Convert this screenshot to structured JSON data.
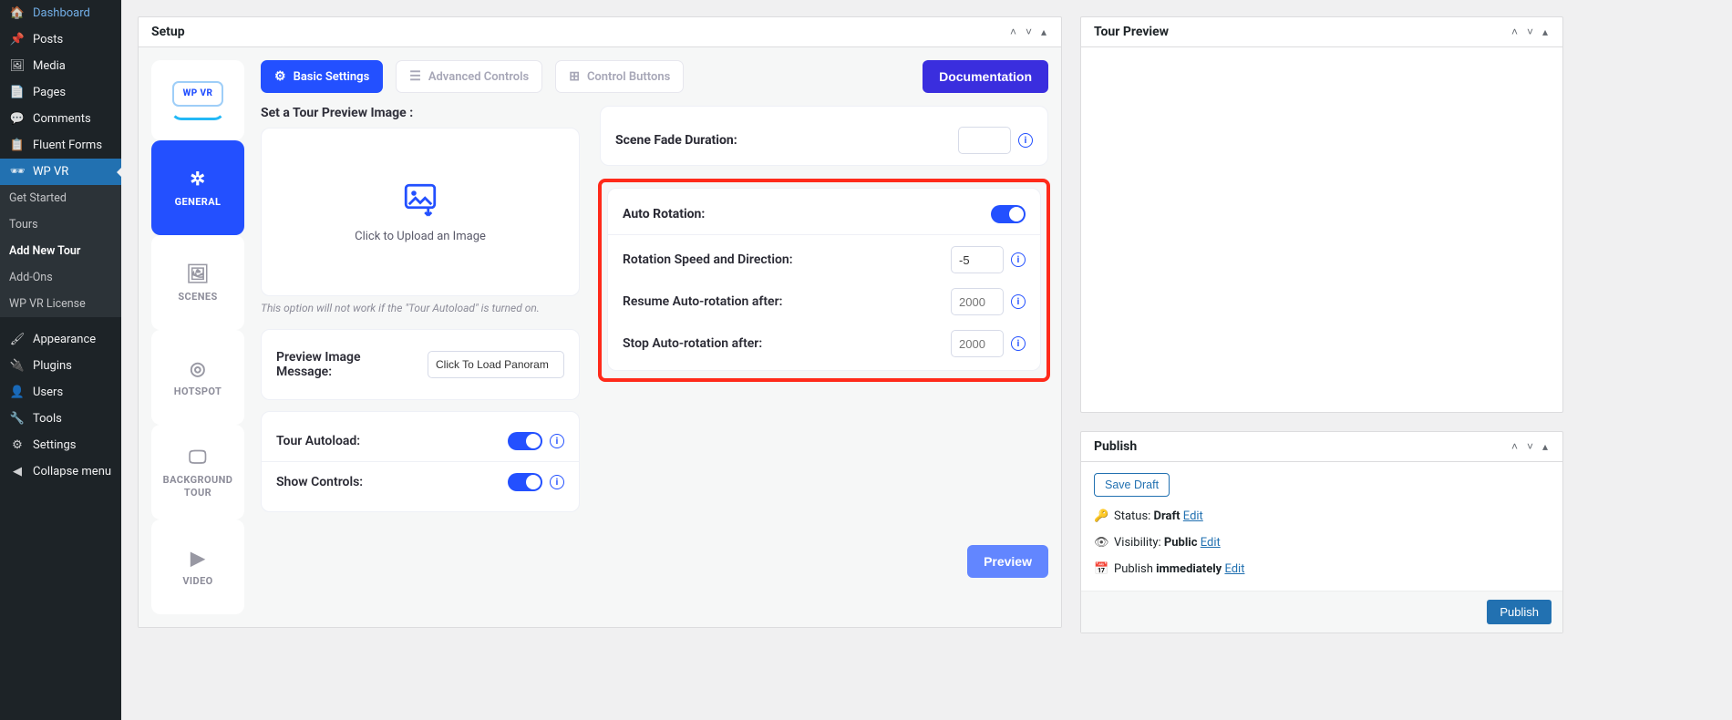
{
  "sidebar": {
    "items": [
      {
        "label": "Dashboard",
        "icon": "🏠"
      },
      {
        "label": "Posts",
        "icon": "📌"
      },
      {
        "label": "Media",
        "icon": "🖼"
      },
      {
        "label": "Pages",
        "icon": "📄"
      },
      {
        "label": "Comments",
        "icon": "💬"
      },
      {
        "label": "Fluent Forms",
        "icon": "📋"
      },
      {
        "label": "WP VR",
        "icon": "🕶",
        "active": true,
        "sub": [
          {
            "label": "Get Started"
          },
          {
            "label": "Tours"
          },
          {
            "label": "Add New Tour",
            "current": true
          },
          {
            "label": "Add-Ons"
          },
          {
            "label": "WP VR License"
          }
        ]
      },
      {
        "label": "Appearance",
        "icon": "🖌"
      },
      {
        "label": "Plugins",
        "icon": "🔌"
      },
      {
        "label": "Users",
        "icon": "👤"
      },
      {
        "label": "Tools",
        "icon": "🔧"
      },
      {
        "label": "Settings",
        "icon": "⚙"
      },
      {
        "label": "Collapse menu",
        "icon": "◀"
      }
    ]
  },
  "setup": {
    "title": "Setup",
    "logo_text": "WP VR",
    "vtabs": [
      {
        "label": "GENERAL",
        "icon": "✲"
      },
      {
        "label": "SCENES",
        "icon": "🖼"
      },
      {
        "label": "HOTSPOT",
        "icon": "◎"
      },
      {
        "label": "BACKGROUND TOUR",
        "icon": "🖵"
      },
      {
        "label": "VIDEO",
        "icon": "▶"
      }
    ],
    "tabs": [
      {
        "label": "Basic Settings",
        "icon": "⚙"
      },
      {
        "label": "Advanced Controls",
        "icon": "☰"
      },
      {
        "label": "Control Buttons",
        "icon": "⊞"
      }
    ],
    "doc_btn": "Documentation",
    "preview_btn": "Preview",
    "left": {
      "preview_heading": "Set a Tour Preview Image :",
      "upload_text": "Click to Upload an Image",
      "hint": "This option will not work if the \"Tour Autoload\" is turned on.",
      "preview_msg_label": "Preview Image Message:",
      "preview_msg_value": "Click To Load Panoram",
      "autoload_label": "Tour Autoload:",
      "controls_label": "Show Controls:"
    },
    "right": {
      "fade_label": "Scene Fade Duration:",
      "fade_value": "",
      "auto_label": "Auto Rotation:",
      "speed_label": "Rotation Speed and Direction:",
      "speed_value": "-5",
      "resume_label": "Resume Auto-rotation after:",
      "resume_placeholder": "2000",
      "stop_label": "Stop Auto-rotation after:",
      "stop_placeholder": "2000"
    }
  },
  "tourpreview": {
    "title": "Tour Preview"
  },
  "publish": {
    "title": "Publish",
    "save_draft": "Save Draft",
    "status_label": "Status: ",
    "status_value": "Draft",
    "vis_label": "Visibility: ",
    "vis_value": "Public",
    "sched_label": "Publish ",
    "sched_value": "immediately",
    "edit": "Edit",
    "button": "Publish"
  }
}
